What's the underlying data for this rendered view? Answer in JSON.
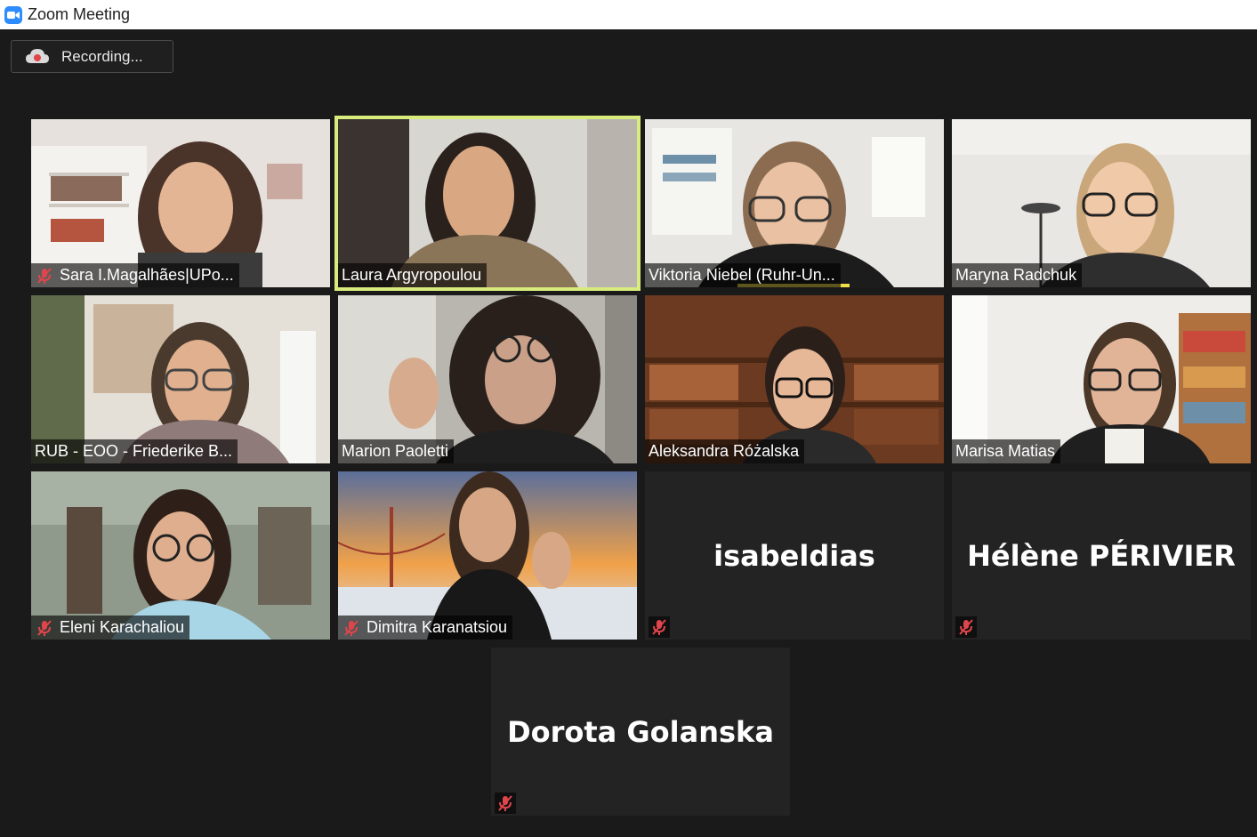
{
  "window": {
    "title": "Zoom Meeting"
  },
  "recording": {
    "label": "Recording..."
  },
  "participants": [
    {
      "name": "Sara I.Magalhães|UPo...",
      "muted": true
    },
    {
      "name": "Laura Argyropoulou",
      "muted": false,
      "active_speaker": true
    },
    {
      "name": "Viktoria Niebel (Ruhr-Un...",
      "muted": false
    },
    {
      "name": "Maryna Radchuk",
      "muted": false
    },
    {
      "name": "RUB - EOO - Friederike B...",
      "muted": false
    },
    {
      "name": "Marion Paoletti",
      "muted": false
    },
    {
      "name": "Aleksandra Różalska",
      "muted": false
    },
    {
      "name": "Marisa Matias",
      "muted": false
    },
    {
      "name": "Eleni Karachaliou",
      "muted": true
    },
    {
      "name": "Dimitra Karanatsiou",
      "muted": true
    },
    {
      "name": "isabeldias",
      "muted": true,
      "video_off": true
    },
    {
      "name": "Hélène PÉRIVIER",
      "muted": true,
      "video_off": true
    },
    {
      "name": "Dorota Golanska",
      "muted": true,
      "video_off": true
    }
  ],
  "colors": {
    "background": "#1a1a1a",
    "active_speaker_border": "#d8eb7d",
    "muted_icon": "#e0454b",
    "brand": "#2d8cff"
  }
}
